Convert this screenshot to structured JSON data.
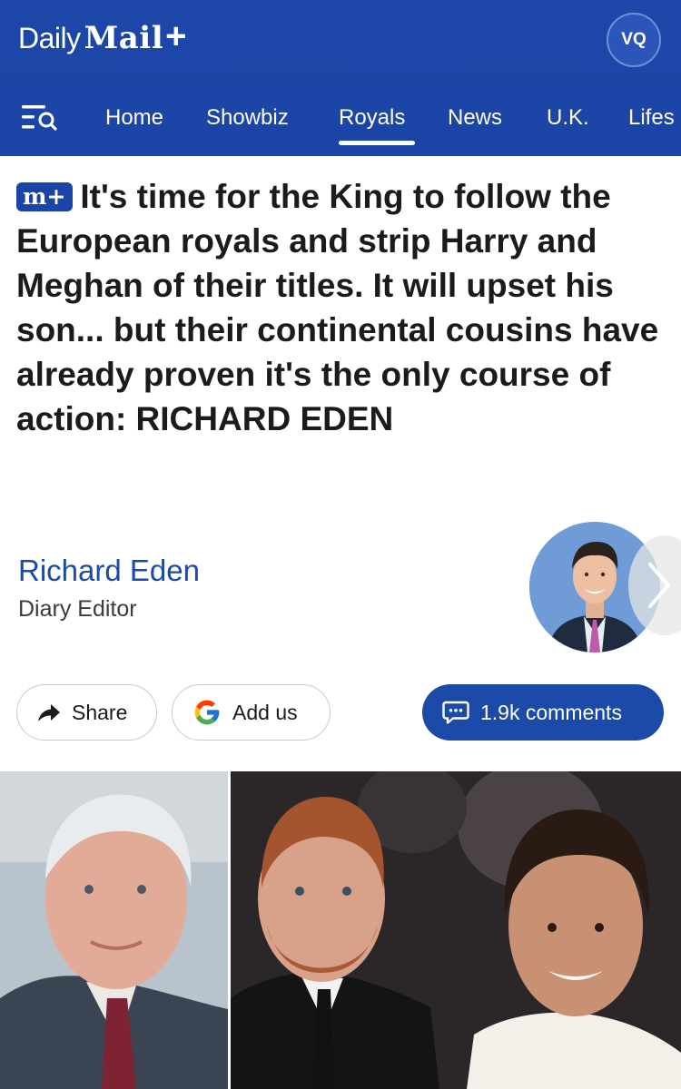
{
  "header": {
    "logo_daily": "Daily",
    "logo_mail": "Mail",
    "logo_plus": "+",
    "avatar_initials": "VQ",
    "brand_color": "#1a44a5"
  },
  "nav": {
    "items": [
      {
        "label": "Home"
      },
      {
        "label": "Showbiz"
      },
      {
        "label": "Royals",
        "active": true
      },
      {
        "label": "News"
      },
      {
        "label": "U.K."
      },
      {
        "label": "Lifes"
      }
    ]
  },
  "article": {
    "badge": "m+",
    "headline": "It's time for the King to follow the European royals and strip Harry and Meghan of their titles. It will upset his son... but their continental cousins have already proven it's the only course of action: RICHARD EDEN"
  },
  "author": {
    "name": "Richard Eden",
    "role": "Diary Editor"
  },
  "actions": {
    "share_label": "Share",
    "addus_label": "Add us",
    "comments_label": "1.9k comments"
  },
  "icons": {
    "menu": "search-menu-icon",
    "share": "share-arrow-icon",
    "google": "google-icon",
    "comments": "comment-bubble-icon",
    "next": "chevron-right-icon"
  }
}
